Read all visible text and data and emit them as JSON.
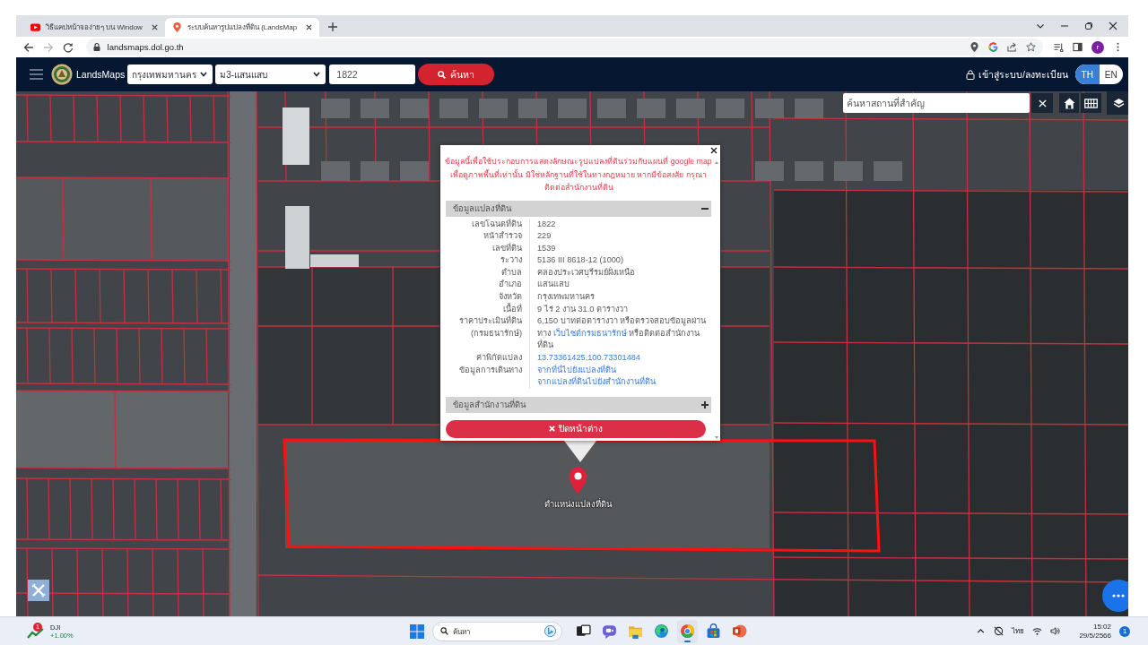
{
  "browser": {
    "tabs": [
      {
        "title": "วิธีแคปหน้าจอง่ายๆ บน Window",
        "kind": "video",
        "selected": false
      },
      {
        "title": "ระบบค้นหารูปแปลงที่ดิน (LandsMap",
        "kind": "pin",
        "selected": true
      }
    ],
    "forward_disabled": true,
    "url": "landsmaps.dol.go.th",
    "profile_initial": "r"
  },
  "navbar": {
    "brand": "LandsMaps",
    "province": "กรุงเทพมหานคร",
    "district": "ม3-แสนแสบ",
    "parcel_number": "1822",
    "search_button": "ค้นหา",
    "login": "เข้าสู่ระบบ/ลงทะเบียน",
    "languages": [
      {
        "label": "TH",
        "selected": true
      },
      {
        "label": "EN",
        "selected": false
      }
    ]
  },
  "map_search": {
    "placeholder": "ค้นหาสถานที่สำคัญ"
  },
  "popup": {
    "notice": "ข้อมูลนี้เพื่อใช้ประกอบการแสดงลักษณะรูปแปลงที่ดินร่วมกับแผนที่ google map เพื่อดูภาพพื้นที่เท่านั้น มิใช่หลักฐานที่ใช้ในทางกฎหมาย หากมีข้อสงสัย กรุณาติดต่อสำนักงานที่ดิน",
    "sections": [
      {
        "title": "ข้อมูลแปลงที่ดิน",
        "expanded": true,
        "rows": [
          {
            "kind": "text",
            "label": "เลขโฉนดที่ดิน",
            "value": "1822"
          },
          {
            "kind": "text",
            "label": "หน้าสำรวจ",
            "value": "229"
          },
          {
            "kind": "text",
            "label": "เลขที่ดิน",
            "value": "1539"
          },
          {
            "kind": "text",
            "label": "ระวาง",
            "value": "5136 III 8618-12 (1000)"
          },
          {
            "kind": "text",
            "label": "ตำบล",
            "value": "คลองประเวศบุรีรมย์ฝั่งเหนือ"
          },
          {
            "kind": "text",
            "label": "อำเภอ",
            "value": "แสนแสบ"
          },
          {
            "kind": "text",
            "label": "จังหวัด",
            "value": "กรุงเทพมหานคร"
          },
          {
            "kind": "text",
            "label": "เนื้อที่",
            "value": "9 ไร่ 2 งาน 31.0 ตารางวา"
          },
          {
            "kind": "price",
            "label": "ราคาประเมินที่ดิน (กรมธนารักษ์)",
            "value": "6,150 บาทต่อตารางวา หรือตรวจสอบข้อมูลผ่านทาง",
            "link": "เว็บไซต์กรมธนารักษ์",
            "value_after": "หรือติดต่อสำนักงานที่ดิน"
          },
          {
            "kind": "link",
            "label": "ค่าพิกัดแปลง",
            "value": "13.73361425,100.73301484"
          },
          {
            "kind": "links",
            "label": "ข้อมูลการเดินทาง",
            "links": [
              "จากที่นี่ไปยังแปลงที่ดิน",
              "จากแปลงที่ดินไปยังสำนักงานที่ดิน"
            ]
          }
        ]
      },
      {
        "title": "ข้อมูลสำนักงานที่ดิน",
        "expanded": false
      }
    ],
    "close_button": "ปิดหน้าต่าง"
  },
  "marker": {
    "label": "ตำแหน่งแปลงที่ดิน"
  },
  "taskbar": {
    "widget": {
      "badge": "1",
      "name": "DJI",
      "change": "+1.00%"
    },
    "search_placeholder": "ค้นหา",
    "apps": [
      {
        "kind": "taskview",
        "selected": false
      },
      {
        "kind": "chat",
        "selected": false
      },
      {
        "kind": "files",
        "selected": false
      },
      {
        "kind": "edge",
        "selected": false
      },
      {
        "kind": "chrome",
        "selected": true
      },
      {
        "kind": "store",
        "selected": false
      },
      {
        "kind": "powerpoint",
        "selected": false
      }
    ],
    "language": "ไทย",
    "time": "15:02",
    "date": "29/5/2566",
    "notification_count": "1"
  }
}
